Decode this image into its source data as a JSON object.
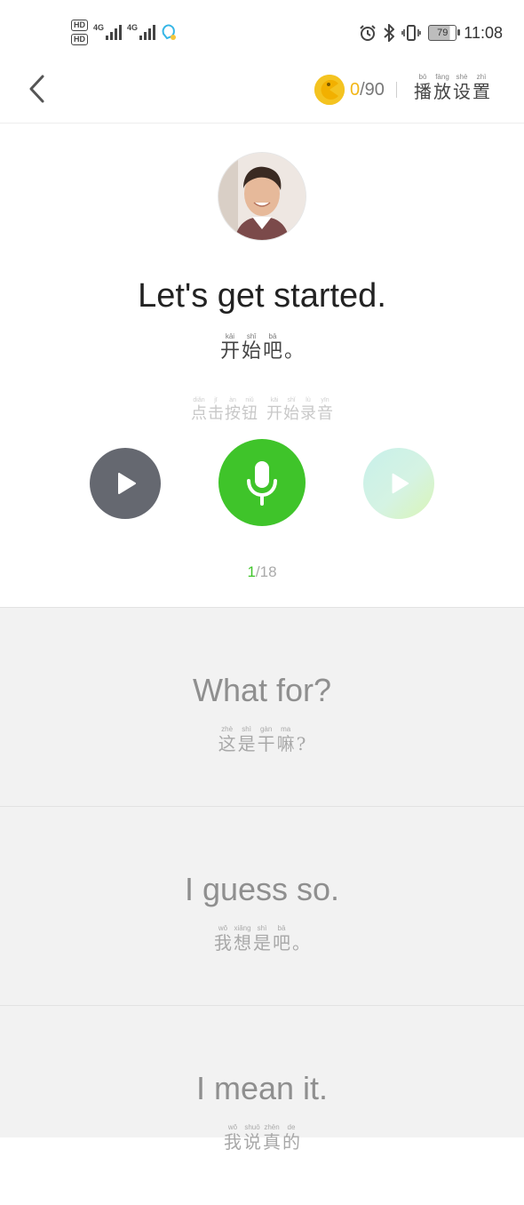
{
  "status_bar": {
    "hd1": "HD",
    "hd2": "HD",
    "net1": "4G",
    "net2": "4G",
    "battery": "79",
    "time": "11:08"
  },
  "header": {
    "coins_current": "0",
    "coins_total": "/90",
    "play_settings": [
      {
        "py": "bō",
        "hz": "播"
      },
      {
        "py": "fàng",
        "hz": "放"
      },
      {
        "py": "shè",
        "hz": "设"
      },
      {
        "py": "zhì",
        "hz": "置"
      }
    ]
  },
  "current": {
    "sentence": "Let's get started.",
    "chinese": [
      {
        "py": "kāi",
        "hz": "开"
      },
      {
        "py": "shǐ",
        "hz": "始"
      },
      {
        "py": "bā",
        "hz": "吧"
      },
      {
        "py": "",
        "hz": "。"
      }
    ],
    "hint_part1": [
      {
        "py": "diǎn",
        "hz": "点"
      },
      {
        "py": "jī",
        "hz": "击"
      },
      {
        "py": "àn",
        "hz": "按"
      },
      {
        "py": "niǔ",
        "hz": "钮"
      }
    ],
    "hint_part2": [
      {
        "py": "kāi",
        "hz": "开"
      },
      {
        "py": "shǐ",
        "hz": "始"
      },
      {
        "py": "lù",
        "hz": "录"
      },
      {
        "py": "yīn",
        "hz": "音"
      }
    ]
  },
  "progress": {
    "current": "1",
    "total": "/18"
  },
  "list": [
    {
      "en": "What for?",
      "cn": [
        {
          "py": "zhè",
          "hz": "这"
        },
        {
          "py": "shì",
          "hz": "是"
        },
        {
          "py": "gàn",
          "hz": "干"
        },
        {
          "py": "ma",
          "hz": "嘛"
        },
        {
          "py": "",
          "hz": "?"
        }
      ]
    },
    {
      "en": "I guess so.",
      "cn": [
        {
          "py": "wǒ",
          "hz": "我"
        },
        {
          "py": "xiǎng",
          "hz": "想"
        },
        {
          "py": "shì",
          "hz": "是"
        },
        {
          "py": "bā",
          "hz": "吧"
        },
        {
          "py": "",
          "hz": "。"
        }
      ]
    },
    {
      "en": "I mean it.",
      "cn": [
        {
          "py": "wǒ",
          "hz": "我"
        },
        {
          "py": "shuō",
          "hz": "说"
        },
        {
          "py": "zhēn",
          "hz": "真"
        },
        {
          "py": "de",
          "hz": "的"
        }
      ]
    }
  ],
  "colors": {
    "accent_green": "#3fc42a",
    "coin_gold": "#f4c320",
    "play_dark": "#656870"
  },
  "icons": {
    "back": "chevron-left-icon",
    "coin": "pacman-coin-icon",
    "play": "play-icon",
    "record": "microphone-icon"
  }
}
